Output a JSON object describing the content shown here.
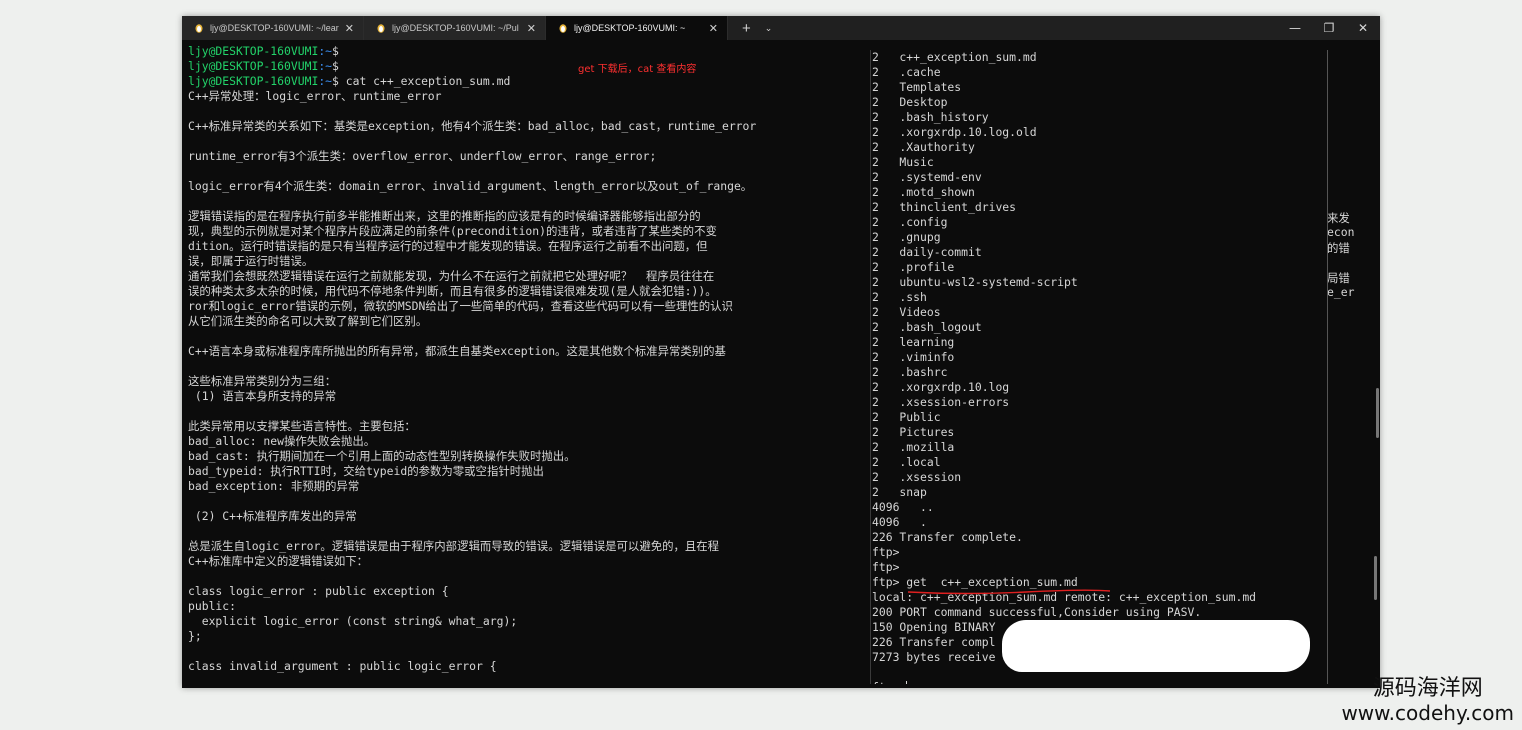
{
  "tabs": [
    {
      "title": "ljy@DESKTOP-160VUMI: ~/lear",
      "icon": "linux-tux-icon",
      "active": false
    },
    {
      "title": "ljy@DESKTOP-160VUMI: ~/Pul",
      "icon": "linux-tux-icon",
      "active": false
    },
    {
      "title": "ljy@DESKTOP-160VUMI: ~",
      "icon": "linux-tux-icon",
      "active": true
    }
  ],
  "new_tab_label": "+",
  "dropdown_label": "⌄",
  "window_controls": {
    "minimize": "—",
    "maximize": "❐",
    "close": "✕"
  },
  "left_prompts": [
    {
      "host": "ljy@DESKTOP-160VUMI",
      "path": ":~",
      "cmd": "$"
    },
    {
      "host": "ljy@DESKTOP-160VUMI",
      "path": ":~",
      "cmd": "$"
    },
    {
      "host": "ljy@DESKTOP-160VUMI",
      "path": ":~",
      "cmd": "$ cat c++_exception_sum.md"
    }
  ],
  "left_lines": [
    "C++异常处理：logic_error、runtime_error",
    "",
    "C++标准异常类的关系如下：基类是exception，他有4个派生类：bad_alloc，bad_cast，runtime_error",
    "",
    "runtime_error有3个派生类：overflow_error、underflow_error、range_error;",
    "",
    "logic_error有4个派生类：domain_error、invalid_argument、length_error以及out_of_range。",
    "",
    "逻辑错误指的是在程序执行前多半能推断出来，这里的推断指的应该是有的时候编译器能够指出部分的",
    "现，典型的示例就是对某个程序片段应满足的前条件(precondition)的违背，或者违背了某些类的不变",
    "dition。运行时错误指的是只有当程序运行的过程中才能发现的错误。在程序运行之前看不出问题，但",
    "误，即属于运行时错误。",
    "通常我们会想既然逻辑错误在运行之前就能发现，为什么不在运行之前就把它处理好呢？  程序员往往在",
    "误的种类太多太杂的时候，用代码不停地条件判断，而且有很多的逻辑错误很难发现(是人就会犯错:))。",
    "ror和logic_error错误的示例，微软的MSDN给出了一些简单的代码，查看这些代码可以有一些理性的认识",
    "从它们派生类的命名可以大致了解到它们区别。",
    "",
    "C++语言本身或标准程序库所抛出的所有异常，都派生自基类exception。这是其他数个标准异常类别的基",
    "",
    "这些标准异常类别分为三组：",
    " (1) 语言本身所支持的异常",
    "",
    "此类异常用以支撑某些语言特性。主要包括：",
    "bad_alloc: new操作失败会抛出。",
    "bad_cast: 执行期间加在一个引用上面的动态性型别转换操作失败时抛出。",
    "bad_typeid: 执行RTTI时，交给typeid的参数为零或空指针时抛出",
    "bad_exception: 非预期的异常",
    "",
    " (2) C++标准程序库发出的异常",
    "",
    "总是派生自logic_error。逻辑错误是由于程序内部逻辑而导致的错误。逻辑错误是可以避免的，且在程",
    "C++标准库中定义的逻辑错误如下：",
    "",
    "class logic_error : public exception {",
    "public:",
    "  explicit logic_error (const string& what_arg);",
    "};",
    "",
    "class invalid_argument : public logic_error {"
  ],
  "annotation": "get 下载后，cat 查看内容",
  "overflow_fragments": [
    "来发",
    "econ",
    "的错",
    "局错",
    "e_er"
  ],
  "right_lines": [
    "2   c++_exception_sum.md",
    "2   .cache",
    "2   Templates",
    "2   Desktop",
    "2   .bash_history",
    "2   .xorgxrdp.10.log.old",
    "2   .Xauthority",
    "2   Music",
    "2   .systemd-env",
    "2   .motd_shown",
    "2   thinclient_drives",
    "2   .config",
    "2   .gnupg",
    "2   daily-commit",
    "2   .profile",
    "2   ubuntu-wsl2-systemd-script",
    "2   .ssh",
    "2   Videos",
    "2   .bash_logout",
    "2   learning",
    "2   .viminfo",
    "2   .bashrc",
    "2   .xorgxrdp.10.log",
    "2   .xsession-errors",
    "2   Public",
    "2   Pictures",
    "2   .mozilla",
    "2   .local",
    "2   .xsession",
    "2   snap",
    "4096   ..",
    "4096   .",
    "226 Transfer complete.",
    "ftp>",
    "ftp>",
    "ftp> get  c++_exception_sum.md",
    "local: c++_exception_sum.md remote: c++_exception_sum.md",
    "200 PORT command successful,Consider using PASV.",
    "150 Opening BINARY",
    "226 Transfer compl",
    "7273 bytes receive",
    "",
    "ftp> "
  ],
  "watermark": {
    "cn": "源码海洋网",
    "url": "www.codehy.com"
  }
}
